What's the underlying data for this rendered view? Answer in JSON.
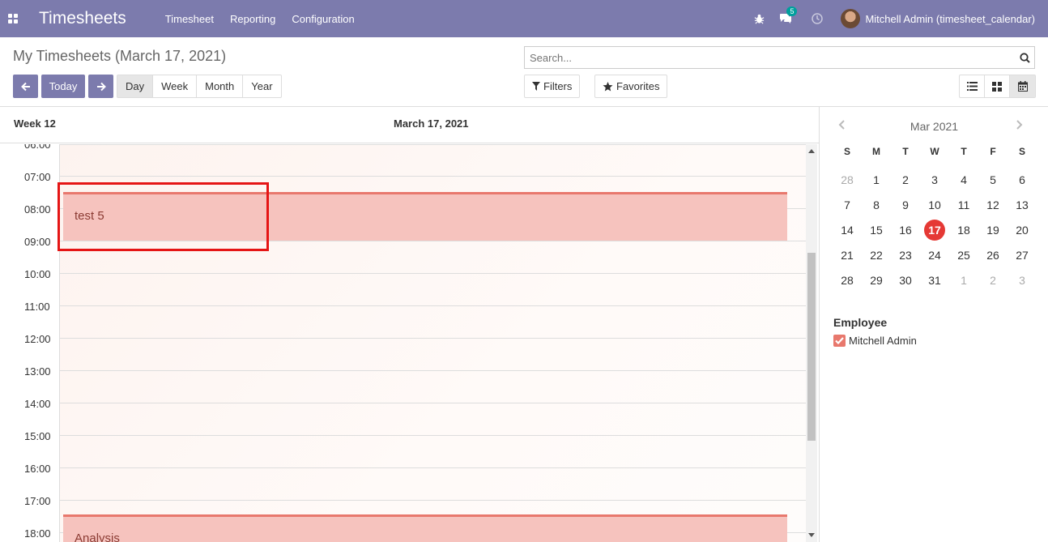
{
  "navbar": {
    "app_title": "Timesheets",
    "menu": [
      "Timesheet",
      "Reporting",
      "Configuration"
    ],
    "messages_count": "5",
    "user": "Mitchell Admin (timesheet_calendar)",
    "bg_color": "#7c7bad"
  },
  "control_panel": {
    "title": "My Timesheets (March 17, 2021)",
    "today_label": "Today",
    "scales": [
      "Day",
      "Week",
      "Month",
      "Year"
    ],
    "active_scale": "Day",
    "search_placeholder": "Search...",
    "filters_label": "Filters",
    "favorites_label": "Favorites",
    "views": [
      "list-icon",
      "kanban-icon",
      "calendar-icon"
    ],
    "active_view": "calendar"
  },
  "calendar": {
    "week_label": "Week 12",
    "date_label": "March 17, 2021",
    "hours": [
      "06:00",
      "07:00",
      "08:00",
      "09:00",
      "10:00",
      "11:00",
      "12:00",
      "13:00",
      "14:00",
      "15:00",
      "16:00",
      "17:00",
      "18:00"
    ],
    "events": [
      {
        "title": "test 5",
        "color": "#f6c3be"
      },
      {
        "title": "Analysis",
        "color": "#f6c3be"
      }
    ]
  },
  "mini_calendar": {
    "month_label": "Mar 2021",
    "weekdays": [
      "S",
      "M",
      "T",
      "W",
      "T",
      "F",
      "S"
    ],
    "weeks": [
      [
        "28",
        "1",
        "2",
        "3",
        "4",
        "5",
        "6"
      ],
      [
        "7",
        "8",
        "9",
        "10",
        "11",
        "12",
        "13"
      ],
      [
        "14",
        "15",
        "16",
        "17",
        "18",
        "19",
        "20"
      ],
      [
        "21",
        "22",
        "23",
        "24",
        "25",
        "26",
        "27"
      ],
      [
        "28",
        "29",
        "30",
        "31",
        "1",
        "2",
        "3"
      ]
    ],
    "today": "17",
    "today_color": "#e53935"
  },
  "filters": {
    "employee_title": "Employee",
    "employees": [
      {
        "name": "Mitchell Admin",
        "checked": true,
        "color": "#e8786d"
      }
    ]
  }
}
